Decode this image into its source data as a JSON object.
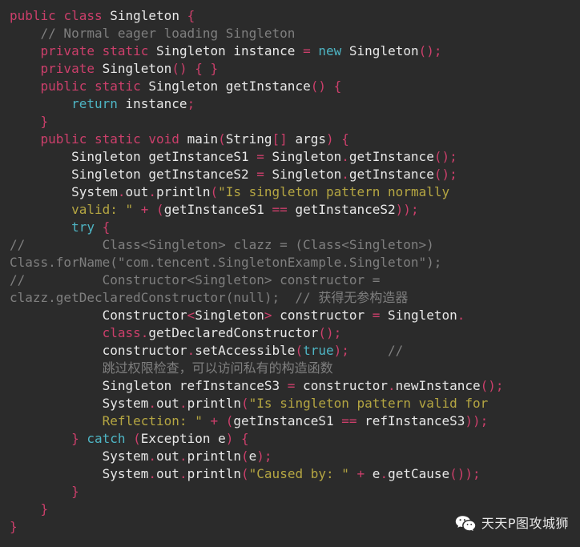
{
  "editor": {
    "background_color": "#2b2b2b",
    "language": "Java",
    "theme_colors": {
      "keyword": "#cc3f6b",
      "control_keyword": "#4eb5c4",
      "plain_text": "#e8e8e8",
      "string": "#b5a642",
      "comment": "#7f7f7f",
      "punctuation": "#cc3f6b"
    }
  },
  "code": {
    "lines": [
      {
        "id": "line-1",
        "tokens": [
          {
            "t": "public",
            "c": "kw"
          },
          {
            "t": " ",
            "c": "pl"
          },
          {
            "t": "class",
            "c": "kw"
          },
          {
            "t": " ",
            "c": "pl"
          },
          {
            "t": "Singleton",
            "c": "pl"
          },
          {
            "t": " ",
            "c": "pl"
          },
          {
            "t": "{",
            "c": "pn"
          }
        ]
      },
      {
        "id": "line-2",
        "tokens": [
          {
            "t": "    ",
            "c": "pl"
          },
          {
            "t": "// Normal eager loading Singleton",
            "c": "cmt"
          }
        ]
      },
      {
        "id": "line-3",
        "tokens": [
          {
            "t": "    ",
            "c": "pl"
          },
          {
            "t": "private",
            "c": "kw"
          },
          {
            "t": " ",
            "c": "pl"
          },
          {
            "t": "static",
            "c": "kw"
          },
          {
            "t": " ",
            "c": "pl"
          },
          {
            "t": "Singleton instance ",
            "c": "pl"
          },
          {
            "t": "=",
            "c": "pn"
          },
          {
            "t": " ",
            "c": "pl"
          },
          {
            "t": "new",
            "c": "ctl"
          },
          {
            "t": " ",
            "c": "pl"
          },
          {
            "t": "Singleton",
            "c": "pl"
          },
          {
            "t": "();",
            "c": "pn"
          }
        ]
      },
      {
        "id": "line-4",
        "tokens": [
          {
            "t": "    ",
            "c": "pl"
          },
          {
            "t": "private",
            "c": "kw"
          },
          {
            "t": " ",
            "c": "pl"
          },
          {
            "t": "Singleton",
            "c": "pl"
          },
          {
            "t": "()",
            "c": "pn"
          },
          {
            "t": " ",
            "c": "pl"
          },
          {
            "t": "{ }",
            "c": "pn"
          }
        ]
      },
      {
        "id": "line-5",
        "tokens": [
          {
            "t": "    ",
            "c": "pl"
          },
          {
            "t": "public",
            "c": "kw"
          },
          {
            "t": " ",
            "c": "pl"
          },
          {
            "t": "static",
            "c": "kw"
          },
          {
            "t": " ",
            "c": "pl"
          },
          {
            "t": "Singleton getInstance",
            "c": "pl"
          },
          {
            "t": "()",
            "c": "pn"
          },
          {
            "t": " ",
            "c": "pl"
          },
          {
            "t": "{",
            "c": "pn"
          }
        ]
      },
      {
        "id": "line-6",
        "tokens": [
          {
            "t": "        ",
            "c": "pl"
          },
          {
            "t": "return",
            "c": "ctl"
          },
          {
            "t": " ",
            "c": "pl"
          },
          {
            "t": "instance",
            "c": "pl"
          },
          {
            "t": ";",
            "c": "pn"
          }
        ]
      },
      {
        "id": "line-7",
        "tokens": [
          {
            "t": "    ",
            "c": "pl"
          },
          {
            "t": "}",
            "c": "pn"
          }
        ]
      },
      {
        "id": "line-8",
        "tokens": [
          {
            "t": "    ",
            "c": "pl"
          },
          {
            "t": "public",
            "c": "kw"
          },
          {
            "t": " ",
            "c": "pl"
          },
          {
            "t": "static",
            "c": "kw"
          },
          {
            "t": " ",
            "c": "pl"
          },
          {
            "t": "void",
            "c": "kw"
          },
          {
            "t": " ",
            "c": "pl"
          },
          {
            "t": "main",
            "c": "pl"
          },
          {
            "t": "(",
            "c": "pn"
          },
          {
            "t": "String",
            "c": "pl"
          },
          {
            "t": "[]",
            "c": "pn"
          },
          {
            "t": " args",
            "c": "pl"
          },
          {
            "t": ")",
            "c": "pn"
          },
          {
            "t": " ",
            "c": "pl"
          },
          {
            "t": "{",
            "c": "pn"
          }
        ]
      },
      {
        "id": "line-9",
        "tokens": [
          {
            "t": "        ",
            "c": "pl"
          },
          {
            "t": "Singleton getInstanceS1 ",
            "c": "pl"
          },
          {
            "t": "=",
            "c": "pn"
          },
          {
            "t": " Singleton",
            "c": "pl"
          },
          {
            "t": ".",
            "c": "pn"
          },
          {
            "t": "getInstance",
            "c": "pl"
          },
          {
            "t": "();",
            "c": "pn"
          }
        ]
      },
      {
        "id": "line-10",
        "tokens": [
          {
            "t": "        ",
            "c": "pl"
          },
          {
            "t": "Singleton getInstanceS2 ",
            "c": "pl"
          },
          {
            "t": "=",
            "c": "pn"
          },
          {
            "t": " Singleton",
            "c": "pl"
          },
          {
            "t": ".",
            "c": "pn"
          },
          {
            "t": "getInstance",
            "c": "pl"
          },
          {
            "t": "();",
            "c": "pn"
          }
        ]
      },
      {
        "id": "line-11",
        "tokens": [
          {
            "t": "        ",
            "c": "pl"
          },
          {
            "t": "System",
            "c": "pl"
          },
          {
            "t": ".",
            "c": "pn"
          },
          {
            "t": "out",
            "c": "pl"
          },
          {
            "t": ".",
            "c": "pn"
          },
          {
            "t": "println",
            "c": "pl"
          },
          {
            "t": "(",
            "c": "pn"
          },
          {
            "t": "\"Is singleton pattern normally",
            "c": "str"
          }
        ]
      },
      {
        "id": "line-12",
        "tokens": [
          {
            "t": "        ",
            "c": "pl"
          },
          {
            "t": "valid: \"",
            "c": "str"
          },
          {
            "t": " ",
            "c": "pl"
          },
          {
            "t": "+",
            "c": "pn"
          },
          {
            "t": " ",
            "c": "pl"
          },
          {
            "t": "(",
            "c": "pn"
          },
          {
            "t": "getInstanceS1 ",
            "c": "pl"
          },
          {
            "t": "==",
            "c": "pn"
          },
          {
            "t": " getInstanceS2",
            "c": "pl"
          },
          {
            "t": "));",
            "c": "pn"
          }
        ]
      },
      {
        "id": "line-13",
        "tokens": [
          {
            "t": "        ",
            "c": "pl"
          },
          {
            "t": "try",
            "c": "ctl"
          },
          {
            "t": " ",
            "c": "pl"
          },
          {
            "t": "{",
            "c": "pn"
          }
        ]
      },
      {
        "id": "line-14",
        "tokens": [
          {
            "t": "//          Class<Singleton> clazz = (Class<Singleton>)",
            "c": "cmt"
          }
        ]
      },
      {
        "id": "line-15",
        "tokens": [
          {
            "t": "Class.forName(\"com.tencent.SingletonExample.Singleton\");",
            "c": "cmt"
          }
        ]
      },
      {
        "id": "line-16",
        "tokens": [
          {
            "t": "//          Constructor<Singleton> constructor =",
            "c": "cmt"
          }
        ]
      },
      {
        "id": "line-17",
        "tokens": [
          {
            "t": "clazz.getDeclaredConstructor(null);  // 获得无参构造器",
            "c": "cmt"
          }
        ]
      },
      {
        "id": "line-18",
        "tokens": [
          {
            "t": "            ",
            "c": "pl"
          },
          {
            "t": "Constructor",
            "c": "pl"
          },
          {
            "t": "<",
            "c": "gn"
          },
          {
            "t": "Singleton",
            "c": "pl"
          },
          {
            "t": ">",
            "c": "gn"
          },
          {
            "t": " constructor ",
            "c": "pl"
          },
          {
            "t": "=",
            "c": "pn"
          },
          {
            "t": " Singleton",
            "c": "pl"
          },
          {
            "t": ".",
            "c": "pn"
          }
        ]
      },
      {
        "id": "line-19",
        "tokens": [
          {
            "t": "            ",
            "c": "pl"
          },
          {
            "t": "class",
            "c": "kw"
          },
          {
            "t": ".",
            "c": "pn"
          },
          {
            "t": "getDeclaredConstructor",
            "c": "pl"
          },
          {
            "t": "();",
            "c": "pn"
          }
        ]
      },
      {
        "id": "line-20",
        "tokens": [
          {
            "t": "            ",
            "c": "pl"
          },
          {
            "t": "constructor",
            "c": "pl"
          },
          {
            "t": ".",
            "c": "pn"
          },
          {
            "t": "setAccessible",
            "c": "pl"
          },
          {
            "t": "(",
            "c": "pn"
          },
          {
            "t": "true",
            "c": "ctl"
          },
          {
            "t": ");",
            "c": "pn"
          },
          {
            "t": "     ",
            "c": "pl"
          },
          {
            "t": "//",
            "c": "cmt"
          }
        ]
      },
      {
        "id": "line-21",
        "tokens": [
          {
            "t": "            ",
            "c": "pl"
          },
          {
            "t": "跳过权限检查，可以访问私有的构造函数",
            "c": "cmt"
          }
        ]
      },
      {
        "id": "line-22",
        "tokens": [
          {
            "t": "            ",
            "c": "pl"
          },
          {
            "t": "Singleton refInstanceS3 ",
            "c": "pl"
          },
          {
            "t": "=",
            "c": "pn"
          },
          {
            "t": " constructor",
            "c": "pl"
          },
          {
            "t": ".",
            "c": "pn"
          },
          {
            "t": "newInstance",
            "c": "pl"
          },
          {
            "t": "();",
            "c": "pn"
          }
        ]
      },
      {
        "id": "line-23",
        "tokens": [
          {
            "t": "            ",
            "c": "pl"
          },
          {
            "t": "System",
            "c": "pl"
          },
          {
            "t": ".",
            "c": "pn"
          },
          {
            "t": "out",
            "c": "pl"
          },
          {
            "t": ".",
            "c": "pn"
          },
          {
            "t": "println",
            "c": "pl"
          },
          {
            "t": "(",
            "c": "pn"
          },
          {
            "t": "\"Is singleton pattern valid for",
            "c": "str"
          }
        ]
      },
      {
        "id": "line-24",
        "tokens": [
          {
            "t": "            ",
            "c": "pl"
          },
          {
            "t": "Reflection: \"",
            "c": "str"
          },
          {
            "t": " ",
            "c": "pl"
          },
          {
            "t": "+",
            "c": "pn"
          },
          {
            "t": " ",
            "c": "pl"
          },
          {
            "t": "(",
            "c": "pn"
          },
          {
            "t": "getInstanceS1 ",
            "c": "pl"
          },
          {
            "t": "==",
            "c": "pn"
          },
          {
            "t": " refInstanceS3",
            "c": "pl"
          },
          {
            "t": "));",
            "c": "pn"
          }
        ]
      },
      {
        "id": "line-25",
        "tokens": [
          {
            "t": "        ",
            "c": "pl"
          },
          {
            "t": "}",
            "c": "pn"
          },
          {
            "t": " ",
            "c": "pl"
          },
          {
            "t": "catch",
            "c": "ctl"
          },
          {
            "t": " ",
            "c": "pl"
          },
          {
            "t": "(",
            "c": "pn"
          },
          {
            "t": "Exception e",
            "c": "pl"
          },
          {
            "t": ")",
            "c": "pn"
          },
          {
            "t": " ",
            "c": "pl"
          },
          {
            "t": "{",
            "c": "pn"
          }
        ]
      },
      {
        "id": "line-26",
        "tokens": [
          {
            "t": "            ",
            "c": "pl"
          },
          {
            "t": "System",
            "c": "pl"
          },
          {
            "t": ".",
            "c": "pn"
          },
          {
            "t": "out",
            "c": "pl"
          },
          {
            "t": ".",
            "c": "pn"
          },
          {
            "t": "println",
            "c": "pl"
          },
          {
            "t": "(",
            "c": "pn"
          },
          {
            "t": "e",
            "c": "pl"
          },
          {
            "t": ");",
            "c": "pn"
          }
        ]
      },
      {
        "id": "line-27",
        "tokens": [
          {
            "t": "            ",
            "c": "pl"
          },
          {
            "t": "System",
            "c": "pl"
          },
          {
            "t": ".",
            "c": "pn"
          },
          {
            "t": "out",
            "c": "pl"
          },
          {
            "t": ".",
            "c": "pn"
          },
          {
            "t": "println",
            "c": "pl"
          },
          {
            "t": "(",
            "c": "pn"
          },
          {
            "t": "\"Caused by: \"",
            "c": "str"
          },
          {
            "t": " ",
            "c": "pl"
          },
          {
            "t": "+",
            "c": "pn"
          },
          {
            "t": " e",
            "c": "pl"
          },
          {
            "t": ".",
            "c": "pn"
          },
          {
            "t": "getCause",
            "c": "pl"
          },
          {
            "t": "());",
            "c": "pn"
          }
        ]
      },
      {
        "id": "line-28",
        "tokens": [
          {
            "t": "        ",
            "c": "pl"
          },
          {
            "t": "}",
            "c": "pn"
          }
        ]
      },
      {
        "id": "line-29",
        "tokens": [
          {
            "t": "    ",
            "c": "pl"
          },
          {
            "t": "}",
            "c": "pn"
          }
        ]
      },
      {
        "id": "line-30",
        "tokens": [
          {
            "t": "}",
            "c": "pn"
          }
        ]
      }
    ]
  },
  "watermark": {
    "icon": "wechat-icon",
    "text": "天天P图攻城狮",
    "text_color": "#e6e6e6"
  }
}
